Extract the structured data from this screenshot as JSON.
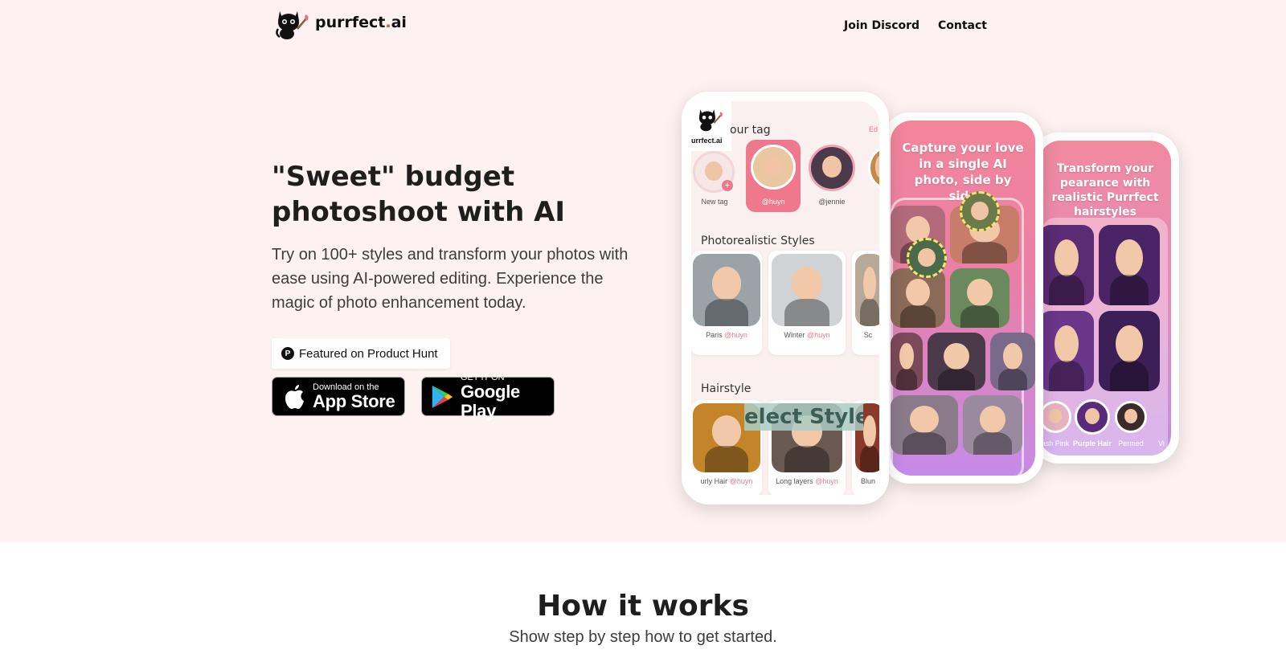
{
  "brand": {
    "name_main": "purrfect",
    "name_dot": ".",
    "name_tld": "ai"
  },
  "nav": {
    "discord": "Join Discord",
    "contact": "Contact"
  },
  "hero": {
    "headline": "\"Sweet\" budget photoshoot with AI",
    "subtext": "Try on 100+ styles and transform your photos with ease using AI-powered editing. Experience the magic of photo enhancement today.",
    "product_hunt": "Featured on Product Hunt",
    "app_store": {
      "small": "Download on the",
      "big": "App Store"
    },
    "google_play": {
      "small": "GET IT ON",
      "big": "Google Play"
    }
  },
  "phone1": {
    "brand": "urrfect.ai",
    "tag_section": "our tag",
    "edit": "Ed",
    "new_tag": "New tag",
    "tags": [
      "@huyn",
      "@jennie"
    ],
    "photo_section": "Photorealistic Styles",
    "photo_styles": [
      {
        "name": "Paris",
        "user": "@huyn"
      },
      {
        "name": "Winter",
        "user": "@huyn"
      },
      {
        "name": "Sc",
        "user": ""
      }
    ],
    "hair_section": "Hairstyle",
    "hair_styles": [
      {
        "name": "urly Hair",
        "user": "@huyn"
      },
      {
        "name": "Long layers",
        "user": "@huyn"
      },
      {
        "name": "Blun",
        "user": ""
      }
    ],
    "overlay": "elect Style"
  },
  "phone2": {
    "caption": "Capture your love in a single AI photo, side by side"
  },
  "phone3": {
    "caption": "Transform your pearance with realistic Purrfect hairstyles",
    "chips": [
      "ash Pink",
      "Purple Hair",
      "Permed",
      "Vi"
    ]
  },
  "how": {
    "title": "How it works",
    "subtitle": "Show step by step how to get started."
  },
  "colors": {
    "hero_bg": "#fdf2f1",
    "accent": "#e44b5a",
    "phone_pink": "#f3859a",
    "phone_purple": "#c58be8"
  }
}
